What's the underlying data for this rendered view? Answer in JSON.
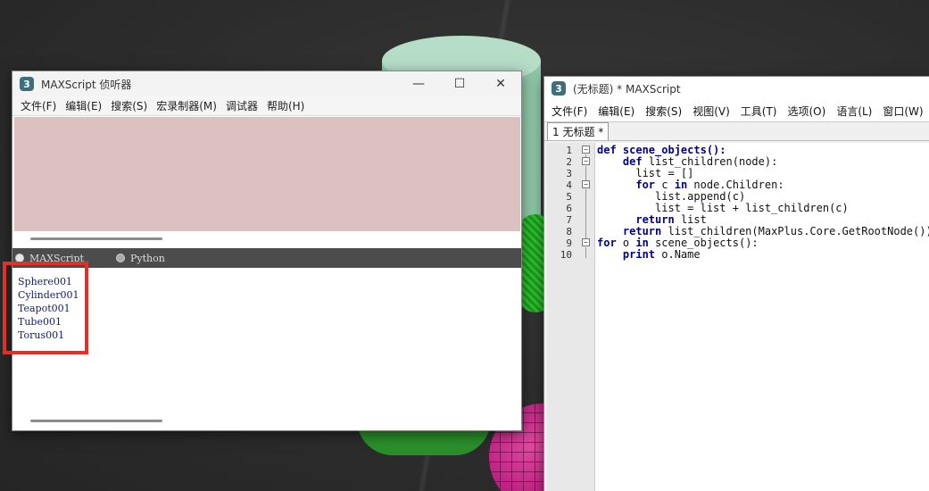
{
  "listener": {
    "icon": "3",
    "title": "MAXScript 侦听器",
    "controls": [
      "—",
      "☐",
      "✕"
    ],
    "menu": [
      "文件(F)",
      "编辑(E)",
      "搜索(S)",
      "宏录制器(M)",
      "调试器",
      "帮助(H)"
    ],
    "languages": [
      "MAXScript",
      "Python"
    ],
    "output_lines": [
      "Sphere001",
      "Cylinder001",
      "Teapot001",
      "Tube001",
      "Torus001"
    ]
  },
  "editor": {
    "icon": "3",
    "title": "(无标题) * MAXScript",
    "menu": [
      "文件(F)",
      "编辑(E)",
      "搜索(S)",
      "视图(V)",
      "工具(T)",
      "选项(O)",
      "语言(L)",
      "窗口(W)"
    ],
    "tab_label": "1 无标题 *",
    "line_numbers": [
      "1",
      "2",
      "3",
      "4",
      "5",
      "6",
      "7",
      "8",
      "9",
      "10"
    ],
    "code_lines": [
      "def scene_objects():",
      "    def list_children(node):",
      "      list = []",
      "      for c in node.Children:",
      "         list.append(c)",
      "         list = list + list_children(c)",
      "      return list",
      "    return list_children(MaxPlus.Core.GetRootNode())",
      "for o in scene_objects():",
      "    print o.Name"
    ]
  },
  "colors": {
    "macro_pane": "#dcc1c1",
    "output_text": "#152070",
    "highlight_box": "#e0302a",
    "keyword": "#00008b"
  }
}
